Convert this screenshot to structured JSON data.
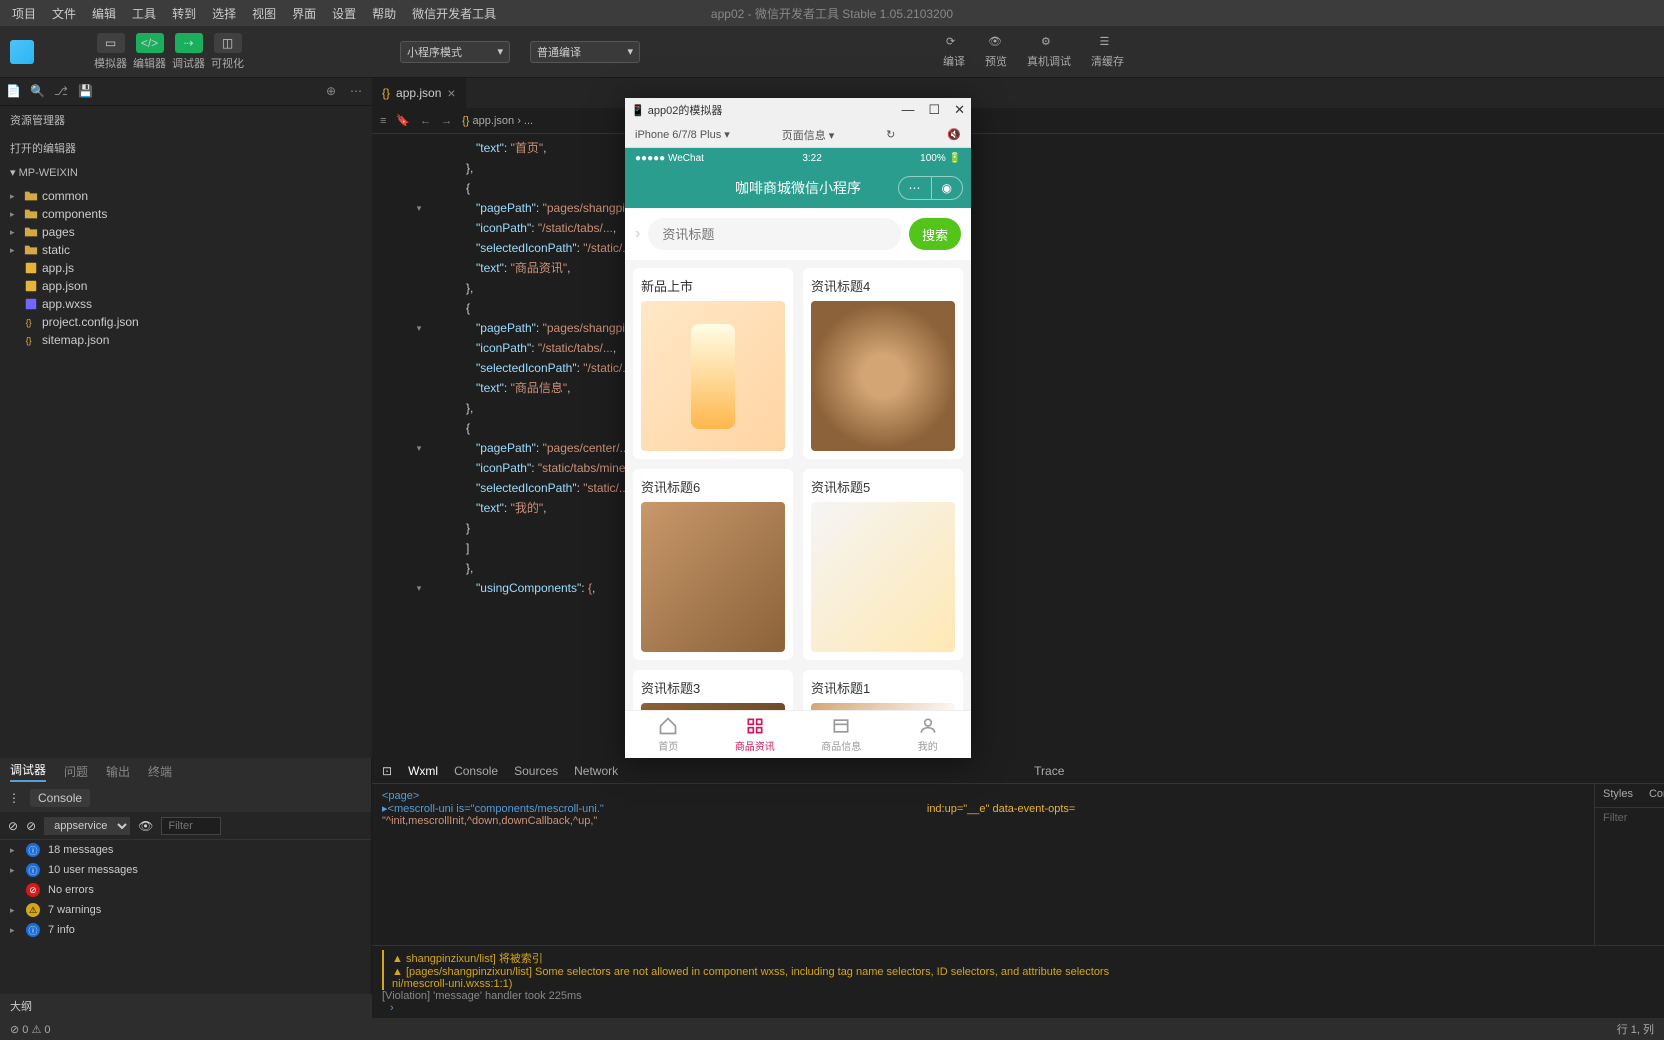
{
  "menubar": [
    "项目",
    "文件",
    "编辑",
    "工具",
    "转到",
    "选择",
    "视图",
    "界面",
    "设置",
    "帮助",
    "微信开发者工具"
  ],
  "window_title": "app02 - 微信开发者工具 Stable 1.05.2103200",
  "toolbar": {
    "buttons": [
      {
        "label": "模拟器"
      },
      {
        "label": "编辑器"
      },
      {
        "label": "调试器"
      },
      {
        "label": "可视化"
      }
    ],
    "mode_select": "小程序模式",
    "compile_select": "普通编译",
    "right": [
      "编译",
      "预览",
      "真机调试",
      "清缓存"
    ]
  },
  "explorer": {
    "header": "资源管理器",
    "section": "打开的编辑器",
    "root": "MP-WEIXIN",
    "items": [
      {
        "name": "common",
        "type": "folder",
        "chev": "▸"
      },
      {
        "name": "components",
        "type": "folder",
        "chev": "▸"
      },
      {
        "name": "pages",
        "type": "folder",
        "chev": "▸"
      },
      {
        "name": "static",
        "type": "folder",
        "chev": "▸"
      },
      {
        "name": "app.js",
        "type": "js"
      },
      {
        "name": "app.json",
        "type": "json"
      },
      {
        "name": "app.wxss",
        "type": "css"
      },
      {
        "name": "project.config.json",
        "type": "json"
      },
      {
        "name": "sitemap.json",
        "type": "json"
      }
    ],
    "outline": "大纲"
  },
  "editor": {
    "tab": "app.json",
    "breadcrumb": "app.json › ...",
    "lines": [
      {
        "n": "",
        "k": "\"text\"",
        "v": "\"首页\""
      },
      {
        "n": "",
        "brace": "},"
      },
      {
        "n": "",
        "brace": "{"
      },
      {
        "n": "",
        "k": "\"pagePath\"",
        "v": "\"pages/shangpinzixun/..."
      },
      {
        "n": "",
        "k": "\"iconPath\"",
        "v": "\"/static/tabs/..."
      },
      {
        "n": "",
        "k": "\"selectedIconPath\"",
        "v": "\"/static/..."
      },
      {
        "n": "",
        "k": "\"text\"",
        "v": "\"商品资讯\""
      },
      {
        "n": "",
        "brace": "},"
      },
      {
        "n": "",
        "brace": "{"
      },
      {
        "n": "",
        "k": "\"pagePath\"",
        "v": "\"pages/shangpinxinxi/..."
      },
      {
        "n": "",
        "k": "\"iconPath\"",
        "v": "\"/static/tabs/..."
      },
      {
        "n": "",
        "k": "\"selectedIconPath\"",
        "v": "\"/static/..."
      },
      {
        "n": "",
        "k": "\"text\"",
        "v": "\"商品信息\""
      },
      {
        "n": "",
        "brace": "},"
      },
      {
        "n": "",
        "brace": "{"
      },
      {
        "n": "",
        "k": "\"pagePath\"",
        "v": "\"pages/center/..."
      },
      {
        "n": "",
        "k": "\"iconPath\"",
        "v": "\"static/tabs/mine..."
      },
      {
        "n": "",
        "k": "\"selectedIconPath\"",
        "v": "\"static/..."
      },
      {
        "n": "",
        "k": "\"text\"",
        "v": "\"我的\""
      },
      {
        "n": "",
        "brace": "}"
      },
      {
        "n": "",
        "brace": "]"
      },
      {
        "n": "",
        "brace": "},"
      },
      {
        "n": "",
        "k": "\"usingComponents\"",
        "v": "{"
      }
    ]
  },
  "debug_panel": {
    "tabs": [
      "调试器",
      "问题",
      "输出",
      "终端"
    ],
    "active": "调试器"
  },
  "devtools": {
    "tabs": [
      "Wxml",
      "Console",
      "Sources",
      "Network",
      "Trace"
    ],
    "body_l1": "<page>",
    "body_l2": "▸<mescroll-uni is=\"components/mescroll-uni.\"",
    "body_l3": "\"^init,mescrollInit,^down,downCallback,^up,\"",
    "body_extra": "ind:up=\"__e\" data-event-opts=",
    "styles_tabs": [
      "Styles",
      "Comp"
    ],
    "filter": "Filter"
  },
  "console": {
    "header": "Console",
    "filter_select": "appservice",
    "filter_placeholder": "Filter",
    "messages": [
      {
        "badge": "blue",
        "text": "18 messages"
      },
      {
        "badge": "blue",
        "text": "10 user messages"
      },
      {
        "badge": "red",
        "text": "No errors"
      },
      {
        "badge": "yellow",
        "text": "7 warnings"
      },
      {
        "badge": "blue",
        "text": "7 info"
      }
    ],
    "logs": [
      {
        "type": "warn",
        "text": "shangpinzixun/list] 将被索引"
      },
      {
        "type": "warn",
        "text": "[pages/shangpinzixun/list] Some selectors are not allowed in component wxss, including tag name selectors, ID selectors, and attribute selectors"
      },
      {
        "type": "warn",
        "text": "ni/mescroll-uni.wxss:1:1)"
      },
      {
        "type": "info",
        "text": "[Violation] 'message' handler took 225ms"
      }
    ]
  },
  "simulator": {
    "title": "app02的模拟器",
    "device": "iPhone 6/7/8 Plus",
    "page_info": "页面信息",
    "status": {
      "wechat": "●●●●● WeChat",
      "time": "3:22",
      "battery": "100%"
    },
    "nav_title": "咖啡商城微信小程序",
    "search_placeholder": "资讯标题",
    "search_btn": "搜索",
    "cards": [
      {
        "title": "新品上市"
      },
      {
        "title": "资讯标题4"
      },
      {
        "title": "资讯标题6"
      },
      {
        "title": "资讯标题5"
      },
      {
        "title": "资讯标题3"
      },
      {
        "title": "资讯标题1"
      }
    ],
    "tabs": [
      "首页",
      "商品资讯",
      "商品信息",
      "我的"
    ]
  },
  "statusbar": {
    "left_icons": "⊘ 0  ⚠ 0",
    "right": "行 1, 列"
  }
}
